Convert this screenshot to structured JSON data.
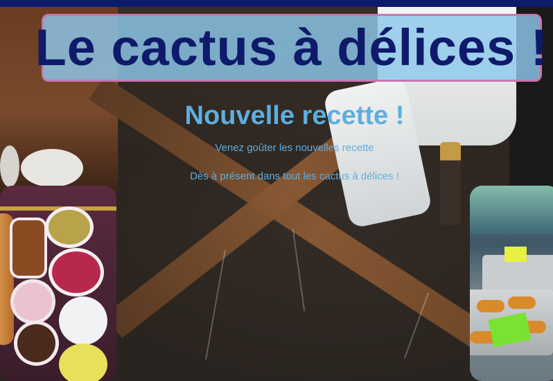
{
  "header": {
    "site_title": "Le cactus à délices !"
  },
  "article": {
    "title": "Nouvelle recette !",
    "paragraph_1": "Venez goûter les nouvelles recette",
    "paragraph_2": "Dès à présent dans tout les cactus à délices !"
  },
  "colors": {
    "top_bar": "#0d1b6b",
    "header_bg": "#8cc8eb",
    "header_border": "#c677b0",
    "title_text": "#0f1a6b",
    "article_text": "#5eaee0"
  }
}
